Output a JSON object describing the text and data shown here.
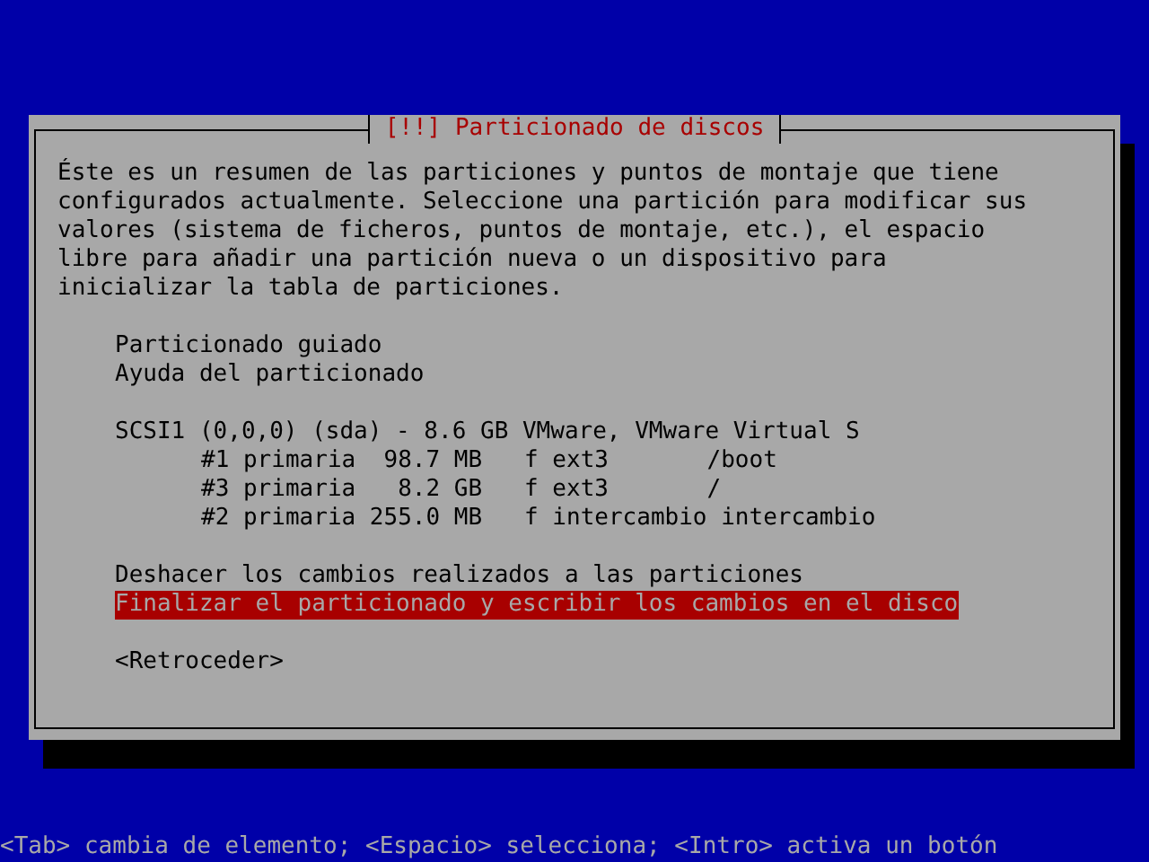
{
  "dialog": {
    "title": "[!!] Particionado de discos",
    "description": "Éste es un resumen de las particiones y puntos de montaje que tiene\nconfigurados actualmente. Seleccione una partición para modificar sus\nvalores (sistema de ficheros, puntos de montaje, etc.), el espacio\nlibre para añadir una partición nueva o un dispositivo para\ninicializar la tabla de particiones.",
    "menu": [
      [
        {
          "text": "Particionado guiado",
          "selected": false
        },
        {
          "text": "Ayuda del particionado",
          "selected": false
        }
      ],
      [
        {
          "text": "SCSI1 (0,0,0) (sda) - 8.6 GB VMware, VMware Virtual S",
          "selected": false,
          "children": [
            {
              "text": "#1 primaria  98.7 MB   f ext3       /boot",
              "selected": false
            },
            {
              "text": "#3 primaria   8.2 GB   f ext3       /",
              "selected": false
            },
            {
              "text": "#2 primaria 255.0 MB   f intercambio intercambio",
              "selected": false
            }
          ]
        }
      ],
      [
        {
          "text": "Deshacer los cambios realizados a las particiones",
          "selected": false
        },
        {
          "text": "Finalizar el particionado y escribir los cambios en el disco",
          "selected": true
        }
      ]
    ],
    "button": "<Retroceder>"
  },
  "status_bar": "<Tab> cambia de elemento; <Espacio> selecciona; <Intro> activa un botón"
}
